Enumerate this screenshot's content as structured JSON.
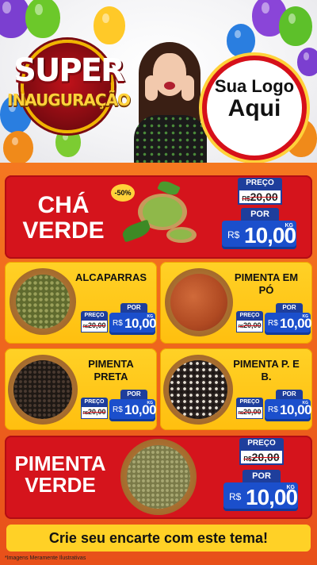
{
  "header": {
    "badge_line1": "SUPER",
    "badge_line2": "INAUGURAÇÃO",
    "logo_line1": "Sua Logo",
    "logo_line2": "Aqui"
  },
  "featured_top": {
    "name_line1": "CHÁ",
    "name_line2": "VERDE",
    "discount": "-50%",
    "price_label": "PREÇO",
    "old_currency": "R$",
    "old_value": "20,00",
    "por_label": "POR",
    "new_currency": "R$",
    "new_value": "10,00",
    "unit": "KG"
  },
  "products": [
    {
      "name": "ALCAPARRAS",
      "price_label": "PREÇO",
      "old_currency": "R$",
      "old_value": "20,00",
      "por_label": "POR",
      "new_currency": "R$",
      "new_value": "10,00",
      "unit": "KG"
    },
    {
      "name": "PIMENTA EM PÓ",
      "price_label": "PREÇO",
      "old_currency": "R$",
      "old_value": "20,00",
      "por_label": "POR",
      "new_currency": "R$",
      "new_value": "10,00",
      "unit": "KG"
    },
    {
      "name": "PIMENTA PRETA",
      "price_label": "PREÇO",
      "old_currency": "R$",
      "old_value": "20,00",
      "por_label": "POR",
      "new_currency": "R$",
      "new_value": "10,00",
      "unit": "KG"
    },
    {
      "name": "PIMENTA P. E B.",
      "price_label": "PREÇO",
      "old_currency": "R$",
      "old_value": "20,00",
      "por_label": "POR",
      "new_currency": "R$",
      "new_value": "10,00",
      "unit": "KG"
    }
  ],
  "featured_bottom": {
    "name_line1": "PIMENTA",
    "name_line2": "VERDE",
    "price_label": "PREÇO",
    "old_currency": "R$",
    "old_value": "20,00",
    "por_label": "POR",
    "new_currency": "R$",
    "new_value": "10,00",
    "unit": "KG"
  },
  "cta": "Crie seu encarte com este tema!",
  "footnote": "*Imagens Meramente Ilustrativas",
  "colors": {
    "primary_red": "#d5141c",
    "card_yellow": "#ffd126",
    "price_blue": "#1b4fcc",
    "background_orange": "#e8501a"
  }
}
